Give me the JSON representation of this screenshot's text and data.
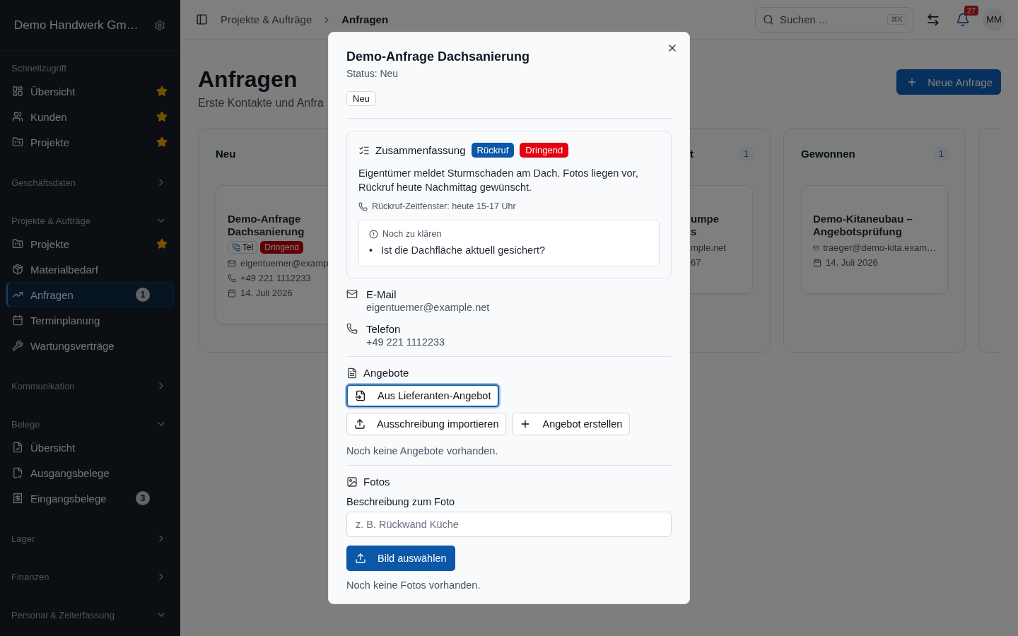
{
  "sidebar": {
    "brand": "Demo Handwerk Gm…",
    "sections": [
      {
        "title": "Schnellzugriff",
        "items": [
          {
            "label": "Übersicht",
            "starred": true,
            "selected": false
          },
          {
            "label": "Kunden",
            "starred": true,
            "selected": false
          },
          {
            "label": "Projekte",
            "starred": true,
            "selected": false
          }
        ]
      },
      {
        "title": "Geschäftsdaten",
        "expanded": false
      },
      {
        "title": "Projekte & Aufträge",
        "expanded": true,
        "items": [
          {
            "label": "Projekte",
            "starred": true,
            "selected": false
          },
          {
            "label": "Materialbedarf",
            "starred": false,
            "selected": false
          },
          {
            "label": "Anfragen",
            "starred": false,
            "selected": true,
            "badge": "1"
          },
          {
            "label": "Terminplanung",
            "starred": false,
            "selected": false
          },
          {
            "label": "Wartungsverträge",
            "starred": false,
            "selected": false
          }
        ]
      },
      {
        "title": "Kommunikation",
        "expanded": false
      },
      {
        "title": "Belege",
        "expanded": true,
        "items": [
          {
            "label": "Übersicht",
            "starred": false,
            "selected": false
          },
          {
            "label": "Ausgangsbelege",
            "starred": false,
            "selected": false
          },
          {
            "label": "Eingangsbelege",
            "starred": false,
            "selected": false,
            "badge": "3"
          }
        ]
      },
      {
        "title": "Lager",
        "expanded": false
      },
      {
        "title": "Finanzen",
        "expanded": false
      },
      {
        "title": "Personal & Zeiterfassung",
        "expanded": true
      }
    ]
  },
  "topbar": {
    "breadcrumbs": [
      "Projekte & Aufträge",
      "Anfragen"
    ],
    "search": {
      "placeholder": "Suchen ...",
      "shortcut": "⌘K"
    },
    "notifications": "27",
    "avatar": "MM"
  },
  "page": {
    "title": "Anfragen",
    "subtitle": "Erste Kontakte und Anfra",
    "new_button": "Neue Anfrage"
  },
  "board": {
    "columns": [
      {
        "kind": "full",
        "title": "Neu",
        "cards": [
          {
            "title": [
              "Demo-Anfrage",
              "Dachsanierung"
            ],
            "tags": [
              {
                "kind": "outline",
                "label": "Tel"
              },
              {
                "kind": "solid",
                "label": "Dringend"
              }
            ],
            "email": "eigentuemer@examp",
            "phone": "+49 221 1112233",
            "date": "14. Juli 2026"
          }
        ]
      },
      {
        "kind": "covered",
        "title": "t",
        "count": "1",
        "cards": [
          {
            "title": [
              "umpe",
              "s"
            ],
            "email": "mple.net",
            "phone": "67"
          }
        ]
      },
      {
        "kind": "full",
        "title": "Gewonnen",
        "count": "1",
        "cards": [
          {
            "title": [
              "Demo-Kitaneubau –",
              "Angebotsprüfung"
            ],
            "email": "traeger@demo-kita.exam…",
            "date": "14. Juli 2026"
          }
        ]
      },
      {
        "kind": "full"
      }
    ]
  },
  "modal": {
    "title": "Demo-Anfrage Dachsanierung",
    "status": "Status: Neu",
    "status_tag": "Neu",
    "summary": {
      "title": "Zusammenfassung",
      "tags": [
        {
          "label": "Rückruf",
          "color": "#0b57a8"
        },
        {
          "label": "Dringend",
          "color": "#e5000f"
        }
      ],
      "text": "Eigentümer meldet Sturmschaden am Dach. Fotos liegen vor, Rückruf heute Nachmittag gewünscht.",
      "callback": "Rückruf-Zeitfenster: heute 15-17 Uhr",
      "open_questions": {
        "title": "Noch zu klären",
        "items": [
          {
            "marker": "•",
            "text": "Ist die Dachfläche aktuell gesichert?"
          }
        ]
      }
    },
    "contacts": [
      {
        "kind": "email",
        "label": "E-Mail",
        "value": "eigentuemer@example.net"
      },
      {
        "kind": "phone",
        "label": "Telefon",
        "value": "+49 221 1112233"
      }
    ],
    "offers": {
      "title": "Angebote",
      "buttons": [
        {
          "kind": "import",
          "label": "Aus Lieferanten-Angebot",
          "focused": true
        },
        {
          "kind": "upload",
          "label": "Ausschreibung importieren",
          "focused": false
        },
        {
          "kind": "create",
          "label": "Angebot erstellen",
          "focused": false
        }
      ],
      "empty": "Noch keine Angebote vorhanden."
    },
    "photos": {
      "title": "Fotos",
      "field_label": "Beschreibung zum Foto",
      "placeholder": "z. B. Rückwand Küche",
      "button": "Bild auswählen",
      "empty": "Noch keine Fotos vorhanden."
    }
  }
}
